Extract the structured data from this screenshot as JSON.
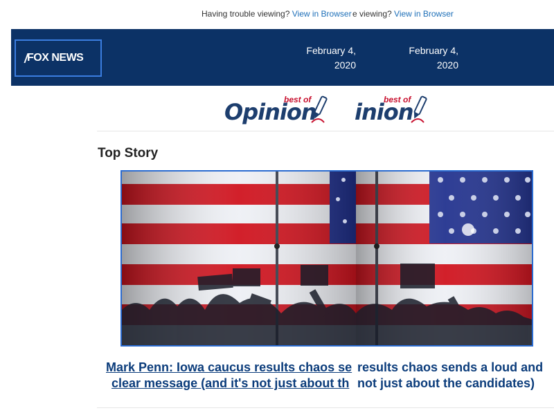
{
  "topbar": {
    "trouble_text": "Having trouble viewing?",
    "trouble_text_cut": "e viewing?",
    "view_link": "View in Browser",
    "view_link_cut": "View in Browser"
  },
  "header": {
    "logo_text": "FOX NEWS",
    "date": "February 4, 2020",
    "date_cut": "February 4, 2020"
  },
  "opinion_logo": {
    "word": "Opinion",
    "word_cut": "inion",
    "badge": "best of"
  },
  "section": {
    "title": "Top Story"
  },
  "story": {
    "headline_left": "Mark Penn: Iowa caucus results chaos se",
    "headline_left_l2": "clear message (and it's not just about th",
    "headline_right": "results chaos sends a loud and",
    "headline_right_l2": "not just about the candidates)"
  },
  "colors": {
    "header_bg": "#0c3266",
    "link": "#1d6fb8",
    "headline": "#0b3c7b",
    "accent_red": "#c8102e"
  }
}
